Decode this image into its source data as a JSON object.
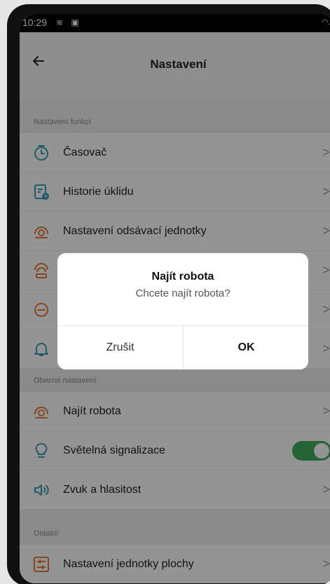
{
  "status_bar": {
    "time": "10:29",
    "left_icons": "≋ ▣",
    "right_icons": "◠.ıl"
  },
  "header": {
    "title": "Nastavení"
  },
  "sections": {
    "features": {
      "title": "Nastavení funkcí"
    },
    "general": {
      "title": "Obecné nastavení"
    },
    "other": {
      "title": "Ostatní"
    }
  },
  "rows": {
    "timer": "Časovač",
    "history": "Historie úklidu",
    "suction": "Nastavení odsávací jednotky",
    "find_robot": "Najít robota",
    "light": "Světelná signalizace",
    "sound": "Zvuk a hlasitost",
    "surface": "Nastavení jednotky plochy"
  },
  "chevron": ">",
  "light_toggle": {
    "on": true
  },
  "dialog": {
    "title": "Najít robota",
    "message": "Chcete najít robota?",
    "cancel": "Zrušit",
    "ok": "OK"
  },
  "colors": {
    "accent": "#3a9eb5",
    "orange": "#e67b3c",
    "toggle_on": "#3fae5e"
  }
}
